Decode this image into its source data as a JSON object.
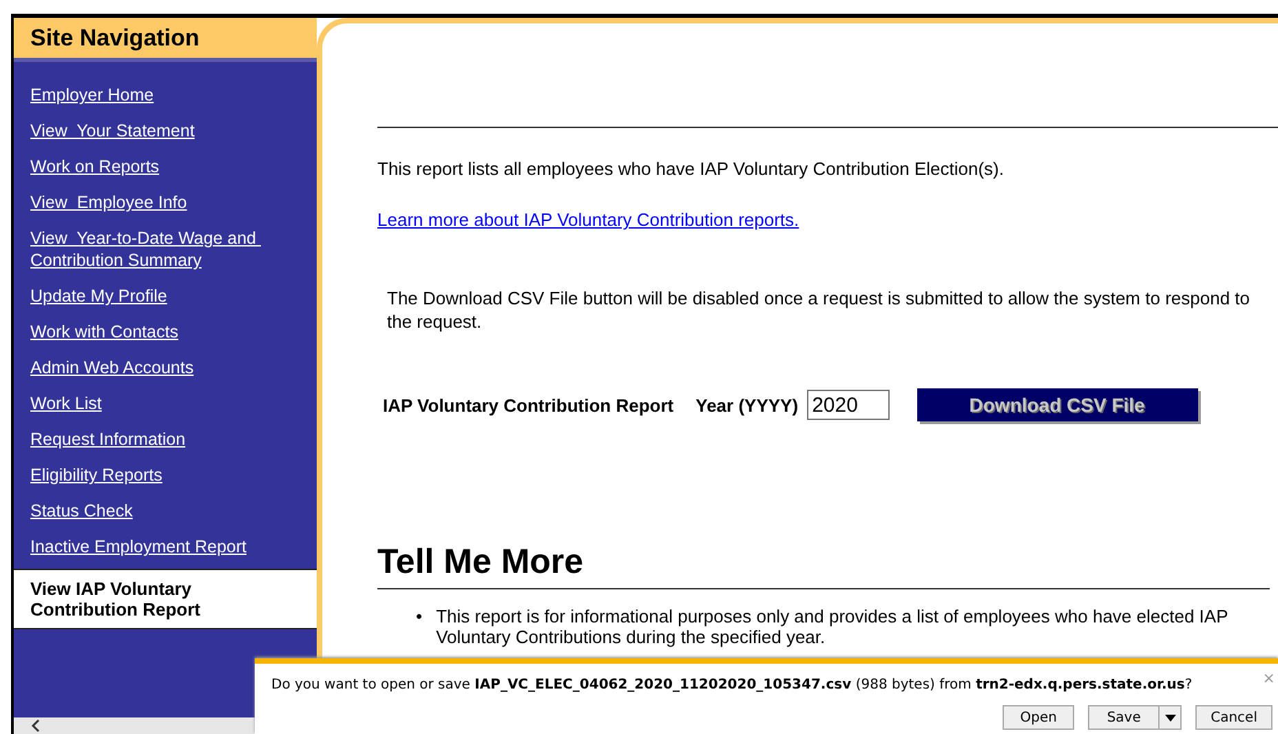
{
  "sidebar": {
    "title": "Site Navigation",
    "items": [
      {
        "label": "Employer Home",
        "selected": false
      },
      {
        "label": "View  Your Statement",
        "selected": false
      },
      {
        "label": "Work on Reports",
        "selected": false
      },
      {
        "label": "View  Employee Info",
        "selected": false
      },
      {
        "label": "View  Year-to-Date Wage and Contribution Summary",
        "selected": false
      },
      {
        "label": "Update My Profile",
        "selected": false
      },
      {
        "label": "Work with Contacts",
        "selected": false
      },
      {
        "label": "Admin Web Accounts",
        "selected": false
      },
      {
        "label": "Work List",
        "selected": false
      },
      {
        "label": "Request Information",
        "selected": false
      },
      {
        "label": "Eligibility Reports",
        "selected": false
      },
      {
        "label": "Status Check",
        "selected": false
      },
      {
        "label": "Inactive Employment Report",
        "selected": false
      },
      {
        "label": "View IAP Voluntary Contribution Report",
        "selected": true
      }
    ]
  },
  "main": {
    "intro": "This report lists all employees who have IAP Voluntary Contribution Election(s).",
    "learn_more_link": "Learn more about IAP Voluntary Contribution reports.",
    "notice": "The Download CSV File button will be disabled once a request is submitted to allow the system to respond to the request.",
    "form": {
      "report_label": "IAP Voluntary Contribution Report",
      "year_label": "Year (YYYY)",
      "year_value": "2020",
      "download_button": "Download CSV File"
    },
    "section_heading": "Tell Me More",
    "bullets": [
      {
        "marker": "•",
        "text": "This report is for informational purposes only and provides a list of employees who have elected IAP Voluntary Contributions during the specified year."
      }
    ]
  },
  "download_bar": {
    "message": "Do you want to open or save **IAP_VC_ELEC_04062_2020_11202020_105347.csv** (988 bytes) from **trn2-edx.q.pers.state.or.us**?",
    "buttons": [
      "Open",
      "Save",
      "Cancel"
    ],
    "close": "×"
  }
}
